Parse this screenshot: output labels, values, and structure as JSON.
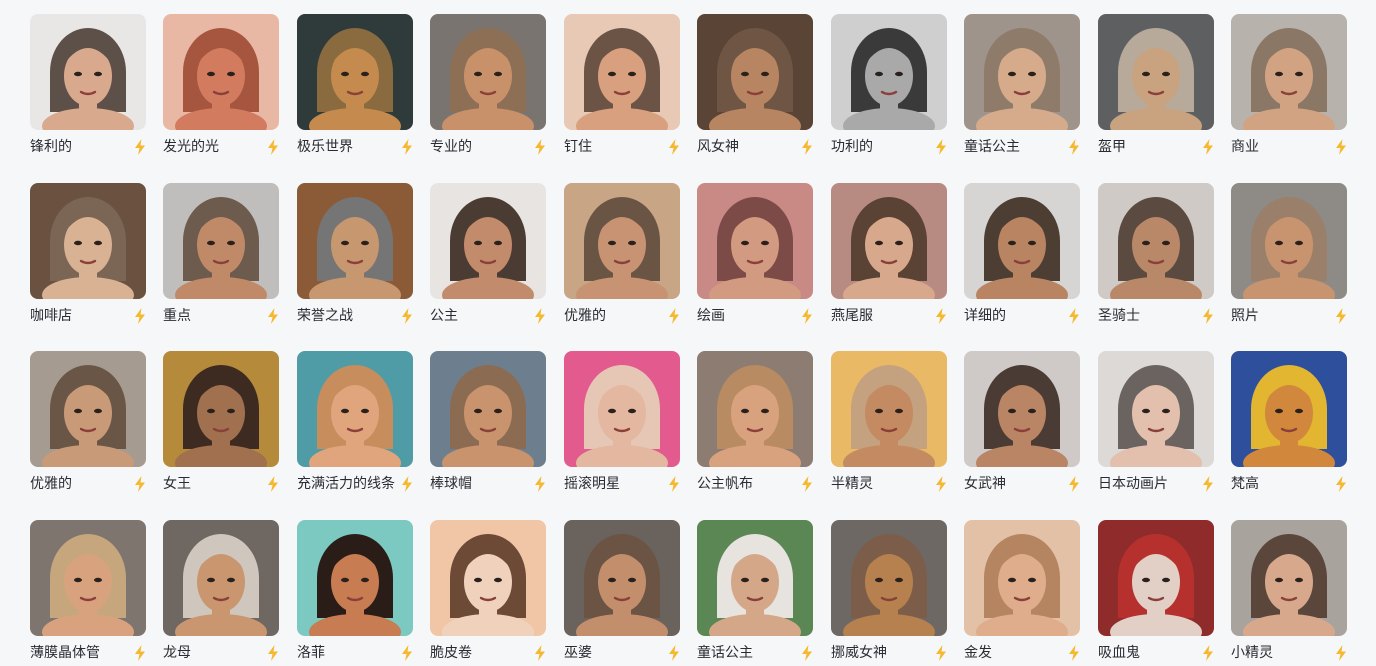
{
  "bolt_color": "#f5b82e",
  "styles": [
    {
      "label": "锋利的",
      "bg": "#e9e7e5",
      "hair": "#5d5048",
      "skin": "#d9a98e",
      "icon": "lightning-icon"
    },
    {
      "label": "发光的光",
      "bg": "#e9b8a4",
      "hair": "#a6553f",
      "skin": "#d27b5e",
      "icon": "lightning-icon"
    },
    {
      "label": "极乐世界",
      "bg": "#2f3a3a",
      "hair": "#8a6a3f",
      "skin": "#c48a4e",
      "icon": "lightning-icon"
    },
    {
      "label": "专业的",
      "bg": "#7a7470",
      "hair": "#8c6f55",
      "skin": "#c8916a",
      "icon": "lightning-icon"
    },
    {
      "label": "钉住",
      "bg": "#e8c9b5",
      "hair": "#6b5446",
      "skin": "#d8a07e",
      "icon": "lightning-icon"
    },
    {
      "label": "风女神",
      "bg": "#5a4436",
      "hair": "#6f5644",
      "skin": "#b88563",
      "icon": "lightning-icon"
    },
    {
      "label": "功利的",
      "bg": "#cfcfcf",
      "hair": "#3a3a3a",
      "skin": "#a9a9a9",
      "icon": "lightning-icon"
    },
    {
      "label": "童话公主",
      "bg": "#9f948c",
      "hair": "#8f7b6a",
      "skin": "#d6ab8c",
      "icon": "lightning-icon"
    },
    {
      "label": "盔甲",
      "bg": "#5d5f60",
      "hair": "#b7aa9a",
      "skin": "#c9a27f",
      "icon": "lightning-icon"
    },
    {
      "label": "商业",
      "bg": "#b8b2ac",
      "hair": "#8b7765",
      "skin": "#d2a382",
      "icon": "lightning-icon"
    },
    {
      "label": "咖啡店",
      "bg": "#6b5140",
      "hair": "#7b6656",
      "skin": "#d9b193",
      "icon": "lightning-icon"
    },
    {
      "label": "重点",
      "bg": "#c0bebc",
      "hair": "#6d5b4d",
      "skin": "#c08a68",
      "icon": "lightning-icon"
    },
    {
      "label": "荣誉之战",
      "bg": "#8b5a37",
      "hair": "#757575",
      "skin": "#c7976f",
      "icon": "lightning-icon"
    },
    {
      "label": "公主",
      "bg": "#e8e4e1",
      "hair": "#4a3c33",
      "skin": "#c28c6c",
      "icon": "lightning-icon"
    },
    {
      "label": "优雅的",
      "bg": "#c7a585",
      "hair": "#6a5545",
      "skin": "#c89372",
      "icon": "lightning-icon"
    },
    {
      "label": "绘画",
      "bg": "#c98a86",
      "hair": "#7c4a47",
      "skin": "#d29a80",
      "icon": "lightning-icon"
    },
    {
      "label": "燕尾服",
      "bg": "#b88b82",
      "hair": "#5a4334",
      "skin": "#d8a88c",
      "icon": "lightning-icon"
    },
    {
      "label": "详细的",
      "bg": "#d7d5d3",
      "hair": "#4d3e34",
      "skin": "#b98462",
      "icon": "lightning-icon"
    },
    {
      "label": "圣骑士",
      "bg": "#cfcac6",
      "hair": "#5a4a3f",
      "skin": "#b98868",
      "icon": "lightning-icon"
    },
    {
      "label": "照片",
      "bg": "#8e8a86",
      "hair": "#9a806a",
      "skin": "#c8946f",
      "icon": "lightning-icon"
    },
    {
      "label": "优雅的",
      "bg": "#a69b90",
      "hair": "#6a5647",
      "skin": "#c99a78",
      "icon": "lightning-icon"
    },
    {
      "label": "女王",
      "bg": "#b58a3a",
      "hair": "#3d2b22",
      "skin": "#a0704f",
      "icon": "lightning-icon"
    },
    {
      "label": "充满活力的线条",
      "bg": "#4f9ca6",
      "hair": "#c88d5d",
      "skin": "#e0a57d",
      "icon": "lightning-icon"
    },
    {
      "label": "棒球帽",
      "bg": "#6d7f8e",
      "hair": "#8b6c52",
      "skin": "#c8936d",
      "icon": "lightning-icon"
    },
    {
      "label": "摇滚明星",
      "bg": "#e35a8e",
      "hair": "#e6c7b6",
      "skin": "#e4b8a0",
      "icon": "lightning-icon"
    },
    {
      "label": "公主帆布",
      "bg": "#8c7c72",
      "hair": "#b88b62",
      "skin": "#d9a27e",
      "icon": "lightning-icon"
    },
    {
      "label": "半精灵",
      "bg": "#e9b965",
      "hair": "#c5a27f",
      "skin": "#c48a61",
      "icon": "lightning-icon"
    },
    {
      "label": "女武神",
      "bg": "#cfcac8",
      "hair": "#4a3c34",
      "skin": "#b98564",
      "icon": "lightning-icon"
    },
    {
      "label": "日本动画片",
      "bg": "#ddd9d7",
      "hair": "#6b6360",
      "skin": "#e3c0ad",
      "icon": "lightning-icon"
    },
    {
      "label": "梵高",
      "bg": "#2e4f9c",
      "hair": "#e2b631",
      "skin": "#d1873c",
      "icon": "lightning-icon"
    },
    {
      "label": "薄膜晶体管",
      "bg": "#7d756e",
      "hair": "#c6a67c",
      "skin": "#d9a27f",
      "icon": "lightning-icon"
    },
    {
      "label": "龙母",
      "bg": "#6f6762",
      "hair": "#cfc7bd",
      "skin": "#c9966f",
      "icon": "lightning-icon"
    },
    {
      "label": "洛菲",
      "bg": "#7bc9c0",
      "hair": "#2a1d18",
      "skin": "#c77c52",
      "icon": "lightning-icon"
    },
    {
      "label": "脆皮卷",
      "bg": "#f1c6a7",
      "hair": "#6c4a36",
      "skin": "#f0d2bc",
      "icon": "lightning-icon"
    },
    {
      "label": "巫婆",
      "bg": "#6a625c",
      "hair": "#6b5444",
      "skin": "#c38e6c",
      "icon": "lightning-icon"
    },
    {
      "label": "童话公主",
      "bg": "#5a8754",
      "hair": "#e7e3de",
      "skin": "#d4a788",
      "icon": "lightning-icon"
    },
    {
      "label": "挪威女神",
      "bg": "#6d6863",
      "hair": "#7b5d49",
      "skin": "#b6804f",
      "icon": "lightning-icon"
    },
    {
      "label": "金发",
      "bg": "#e3c1a6",
      "hair": "#b48560",
      "skin": "#e0ad8c",
      "icon": "lightning-icon"
    },
    {
      "label": "吸血鬼",
      "bg": "#8f2b2a",
      "hair": "#b6312e",
      "skin": "#e2cfc6",
      "icon": "lightning-icon"
    },
    {
      "label": "小精灵",
      "bg": "#a8a39d",
      "hair": "#5a463a",
      "skin": "#d7a88b",
      "icon": "lightning-icon"
    }
  ]
}
